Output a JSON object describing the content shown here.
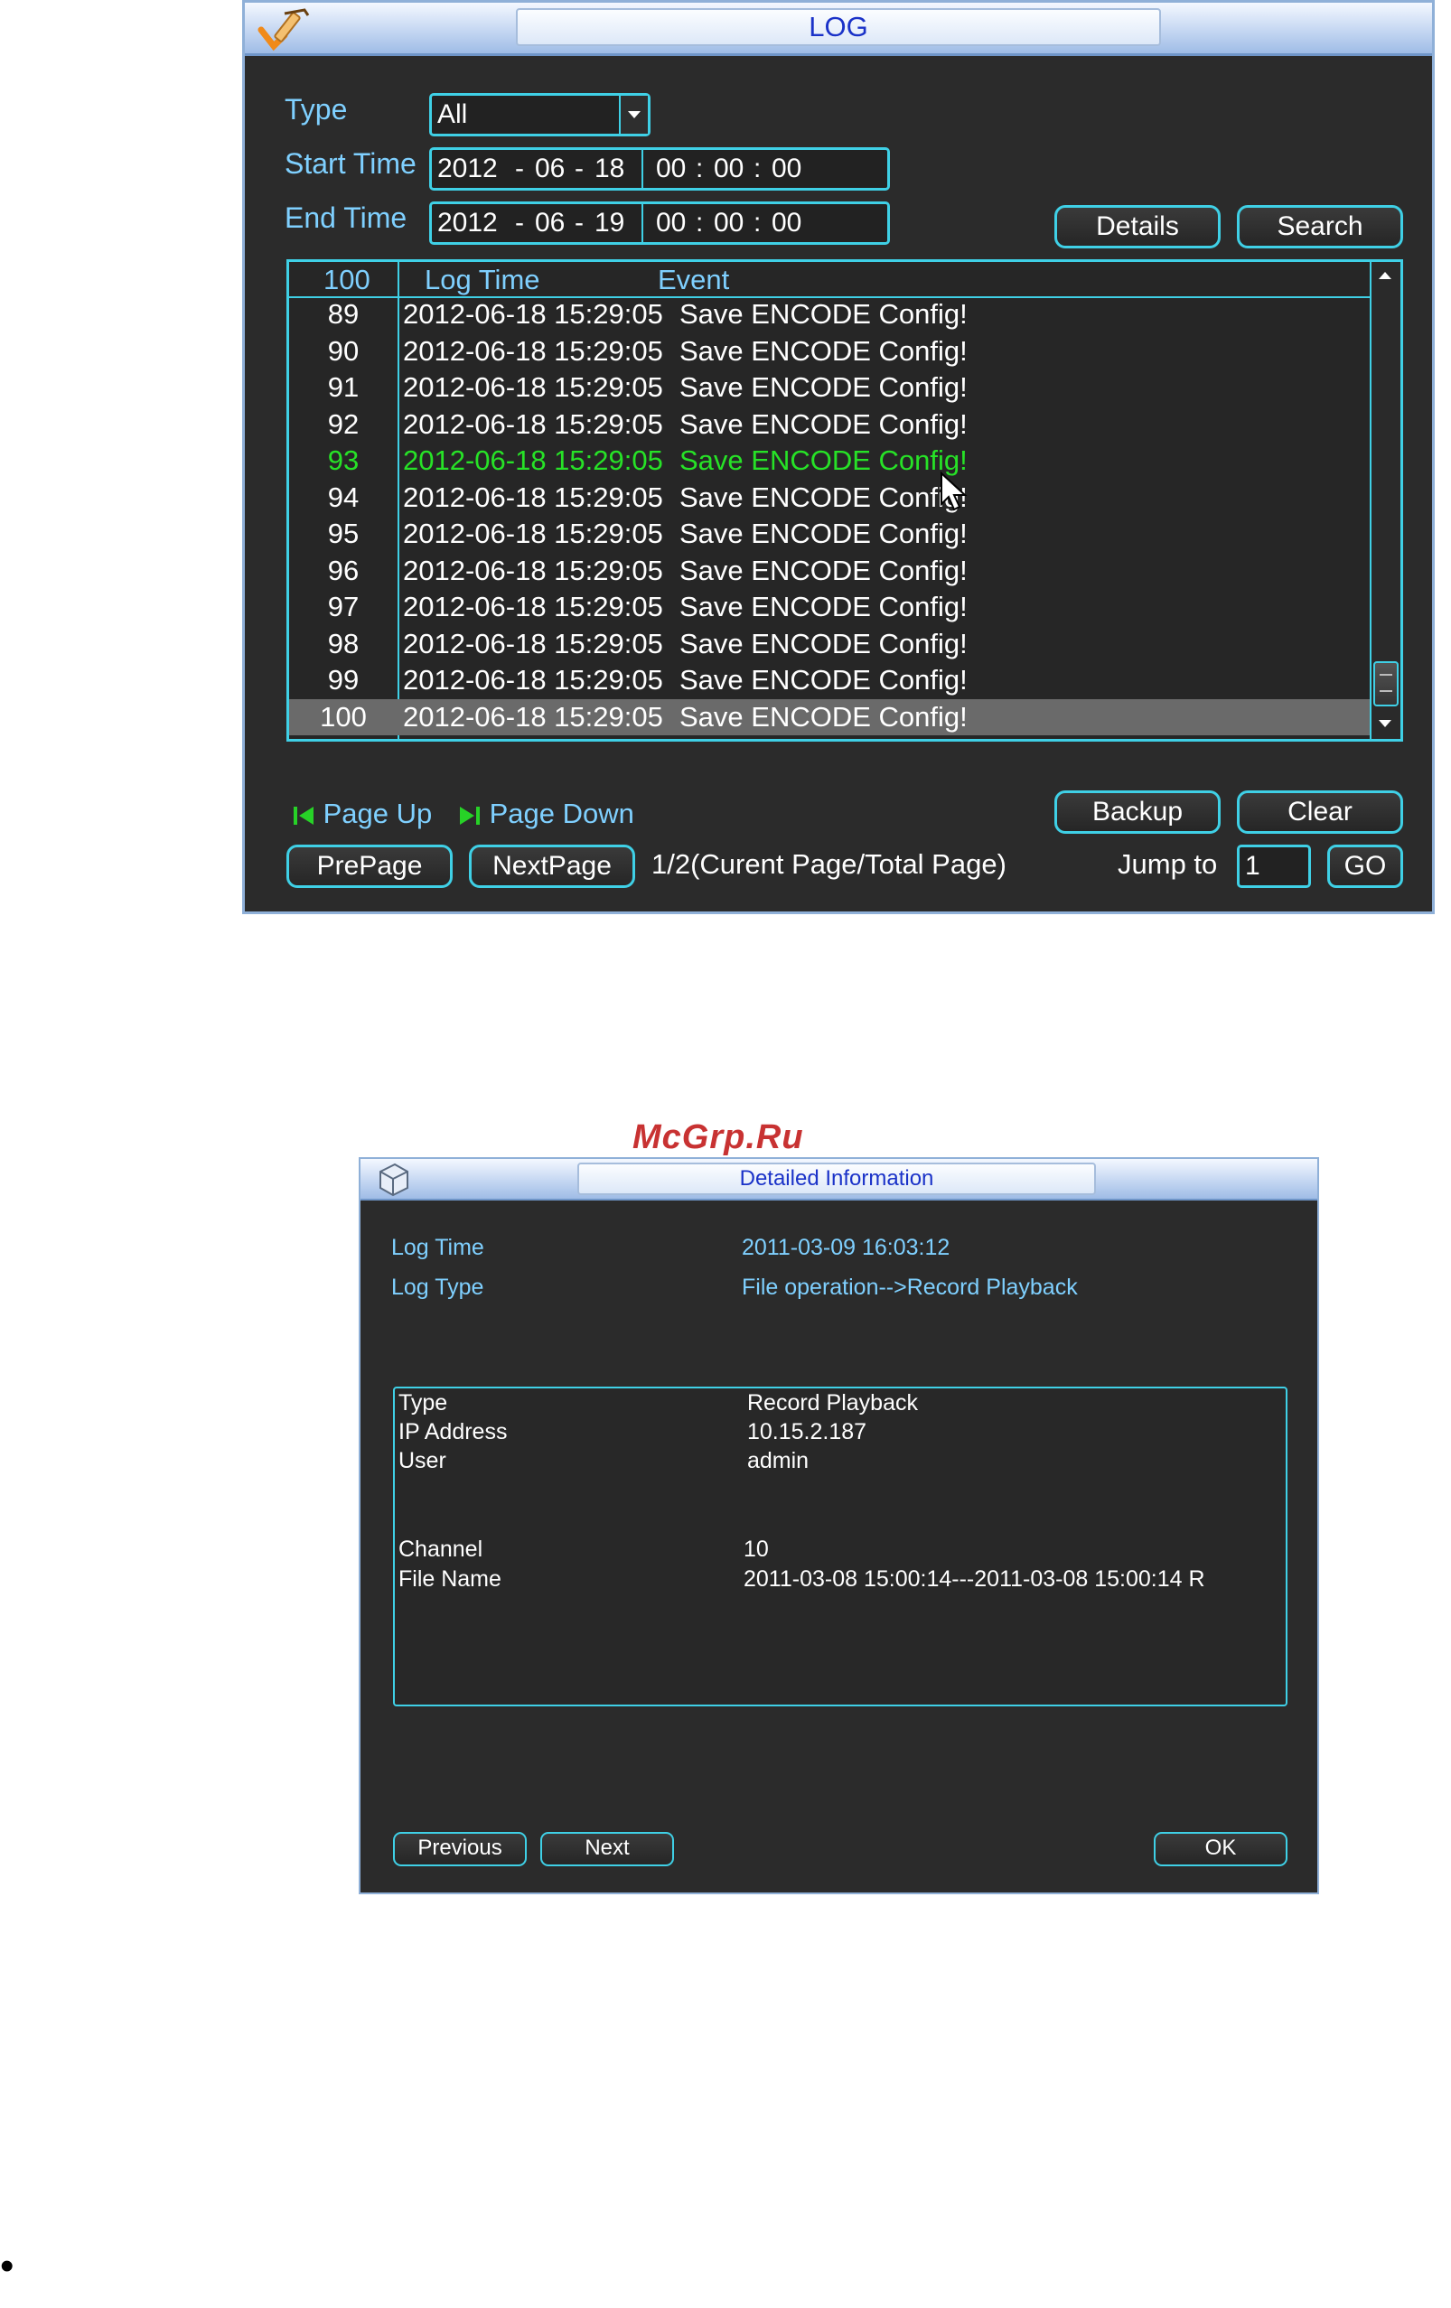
{
  "log_window": {
    "title": "LOG",
    "type_label": "Type",
    "type_value": "All",
    "start_time_label": "Start Time",
    "start_date": [
      "2012",
      "06",
      "18"
    ],
    "start_clock": [
      "00",
      "00",
      "00"
    ],
    "end_time_label": "End Time",
    "end_date": [
      "2012",
      "06",
      "19"
    ],
    "end_clock": [
      "00",
      "00",
      "00"
    ],
    "date_sep": "-",
    "time_sep": ":",
    "details_button": "Details",
    "search_button": "Search",
    "table": {
      "headers": [
        "100",
        "Log Time",
        "Event"
      ],
      "rows": [
        {
          "no": "89",
          "time": "2012-06-18 15:29:05",
          "event": "Save ENCODE Config!"
        },
        {
          "no": "90",
          "time": "2012-06-18 15:29:05",
          "event": "Save ENCODE Config!"
        },
        {
          "no": "91",
          "time": "2012-06-18 15:29:05",
          "event": "Save ENCODE Config!"
        },
        {
          "no": "92",
          "time": "2012-06-18 15:29:05",
          "event": "Save ENCODE Config!"
        },
        {
          "no": "93",
          "time": "2012-06-18 15:29:05",
          "event": "Save ENCODE Config!"
        },
        {
          "no": "94",
          "time": "2012-06-18 15:29:05",
          "event": "Save ENCODE Config!"
        },
        {
          "no": "95",
          "time": "2012-06-18 15:29:05",
          "event": "Save ENCODE Config!"
        },
        {
          "no": "96",
          "time": "2012-06-18 15:29:05",
          "event": "Save ENCODE Config!"
        },
        {
          "no": "97",
          "time": "2012-06-18 15:29:05",
          "event": "Save ENCODE Config!"
        },
        {
          "no": "98",
          "time": "2012-06-18 15:29:05",
          "event": "Save ENCODE Config!"
        },
        {
          "no": "99",
          "time": "2012-06-18 15:29:05",
          "event": "Save ENCODE Config!"
        },
        {
          "no": "100",
          "time": "2012-06-18 15:29:05",
          "event": "Save ENCODE Config!"
        }
      ]
    },
    "page_up": "Page Up",
    "page_down": "Page Down",
    "backup_button": "Backup",
    "clear_button": "Clear",
    "prepage_button": "PrePage",
    "nextpage_button": "NextPage",
    "page_info": "1/2(Curent Page/Total Page)",
    "jump_label": "Jump to",
    "jump_value": "1",
    "go_button": "GO"
  },
  "watermark": "McGrp.Ru",
  "detail_window": {
    "title": "Detailed Information",
    "log_time_label": "Log Time",
    "log_time_value": "2011-03-09 16:03:12",
    "log_type_label": "Log Type",
    "log_type_value": "File operation-->Record Playback",
    "info": [
      {
        "label": "Type",
        "value": "Record Playback"
      },
      {
        "label": "IP Address",
        "value": "10.15.2.187"
      },
      {
        "label": "User",
        "value": "admin"
      },
      {
        "label": "Channel",
        "value": "10"
      },
      {
        "label": "File Name",
        "value": "2011-03-08 15:00:14---2011-03-08 15:00:14 R"
      }
    ],
    "previous_button": "Previous",
    "next_button": "Next",
    "ok_button": "OK"
  },
  "bullet": "•",
  "colors": {
    "panel": "#2b2b2b",
    "label_text": "#7fd0ff",
    "field_border": "#3fd0e6",
    "highlight_row": "#27e227",
    "selected_row": "#6a6a6a",
    "title_text": "#1a32c8",
    "watermark": "#c83232"
  }
}
